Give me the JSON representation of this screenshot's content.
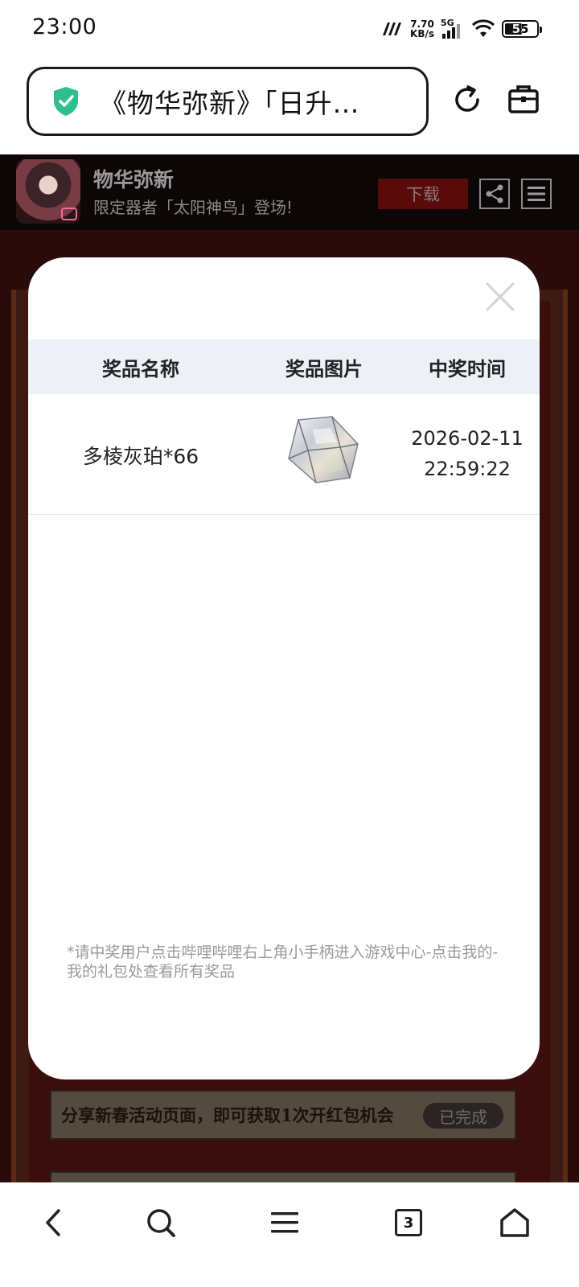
{
  "status_bar": {
    "time": "23:00",
    "net_speed_value": "7.70",
    "net_speed_unit": "KB/s",
    "network_type": "5G",
    "battery": "55",
    "battery_level_percent": 55
  },
  "browser": {
    "url_title": "《物华弥新》「日升…",
    "security_icon": "shield-check-icon",
    "refresh_icon": "refresh-icon",
    "toolbox_icon": "toolbox-icon",
    "accent_color": "#2fbf8f"
  },
  "game_bar": {
    "title": "物华弥新",
    "subtitle": "限定器者「太阳神鸟」登场!",
    "download_label": "下载",
    "share_icon": "share-icon",
    "menu_icon": "menu-icon"
  },
  "modal": {
    "close_icon": "close-icon",
    "headers": [
      "奖品名称",
      "奖品图片",
      "中奖时间"
    ],
    "rows": [
      {
        "name": "多棱灰珀*66",
        "image_icon": "crystal-cube-icon",
        "date": "2026-02-11",
        "time": "22:59:22"
      }
    ],
    "note": "*请中奖用户点击哔哩哔哩右上角小手柄进入游戏中心-点击我的-我的礼包处查看所有奖品"
  },
  "background_task": {
    "text": "分享新春活动页面，即可获取1次开红包机会",
    "status": "已完成"
  },
  "bottom_nav": {
    "back_icon": "back-icon",
    "search_icon": "search-icon",
    "menu_icon": "menu-icon",
    "tabs_count": "3",
    "home_icon": "home-icon"
  }
}
